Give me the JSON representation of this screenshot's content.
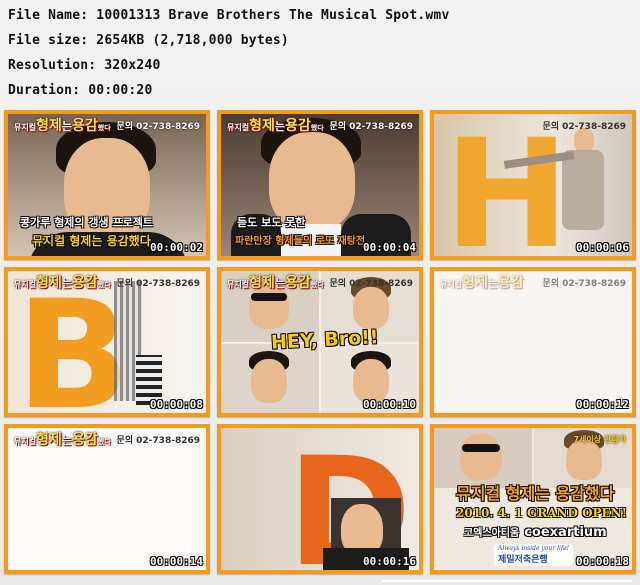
{
  "file_info": {
    "name_line": "File Name: 10001313 Brave Brothers The Musical Spot.wmv",
    "size_line": "File size: 2654KB (2,718,000 bytes)",
    "resolution_line": "Resolution: 320x240",
    "duration_line": "Duration: 00:00:20"
  },
  "logo": {
    "prefix": "뮤지컬",
    "title_a": "형제",
    "mid": "는",
    "title_b": "용감",
    "suffix": "했다"
  },
  "contact": "문의 02-738-8269",
  "thumbnails": [
    {
      "timestamp": "00:00:02",
      "caption_line1": "콩가루 형제의 갱생 프로젝트",
      "caption_line2": "뮤지컬 형제는 용감했다"
    },
    {
      "timestamp": "00:00:04",
      "caption_line1": "듣도 보도 못한",
      "caption_line2": "파란만장 형제들의 로또 재탕전"
    },
    {
      "timestamp": "00:00:06",
      "letter": "H"
    },
    {
      "timestamp": "00:00:08",
      "letter": "B"
    },
    {
      "timestamp": "00:00:10",
      "caption_line1": "HEY, Bro!!"
    },
    {
      "timestamp": "00:00:12"
    },
    {
      "timestamp": "00:00:14"
    },
    {
      "timestamp": "00:00:16",
      "letter": "D"
    },
    {
      "timestamp": "00:00:18",
      "badge": "7세이상 관람가",
      "title": "뮤지컬 형제는 용감했다",
      "open_line": "2010. 4. 1 GRAND OPEN!",
      "venue_ko": "코엑스아티움",
      "venue_en": "coexartium",
      "sponsor_tagline": "Always inside your life!",
      "sponsor": "제일저축은행"
    }
  ],
  "colors": {
    "frame": "#f39a1f",
    "accent_yellow": "#ffd200",
    "caption_orange": "#ff9a1a"
  }
}
